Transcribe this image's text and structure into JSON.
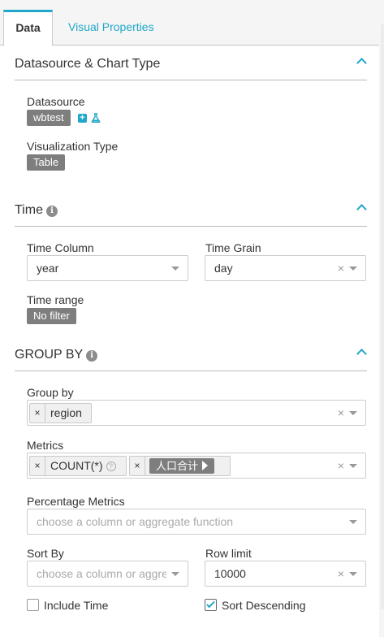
{
  "tabs": {
    "data": "Data",
    "visual": "Visual Properties"
  },
  "sections": {
    "datasource": {
      "title": "Datasource & Chart Type",
      "datasource_label": "Datasource",
      "datasource_value": "wbtest",
      "viz_label": "Visualization Type",
      "viz_value": "Table"
    },
    "time": {
      "title": "Time",
      "time_column_label": "Time Column",
      "time_column_value": "year",
      "time_grain_label": "Time Grain",
      "time_grain_value": "day",
      "time_range_label": "Time range",
      "time_range_value": "No filter"
    },
    "groupby": {
      "title": "GROUP BY",
      "group_by_label": "Group by",
      "group_by_chips": [
        "region"
      ],
      "metrics_label": "Metrics",
      "metrics": [
        "COUNT(*)",
        "人口合计"
      ],
      "percentage_label": "Percentage Metrics",
      "percentage_placeholder": "choose a column or aggregate function",
      "sort_by_label": "Sort By",
      "sort_by_placeholder": "choose a column or aggre...",
      "row_limit_label": "Row limit",
      "row_limit_value": "10000",
      "include_time_label": "Include Time",
      "include_time_checked": false,
      "sort_desc_label": "Sort Descending",
      "sort_desc_checked": true
    }
  },
  "icons": {
    "info": "info-icon",
    "collapse": "chevron-up-icon",
    "add_datasource": "plus-icon",
    "explore": "flask-icon",
    "help": "question-icon"
  },
  "colors": {
    "accent": "#20a7c9",
    "pill": "#7e7e7e",
    "panel": "#ffffff",
    "background": "#f5f5f5"
  }
}
